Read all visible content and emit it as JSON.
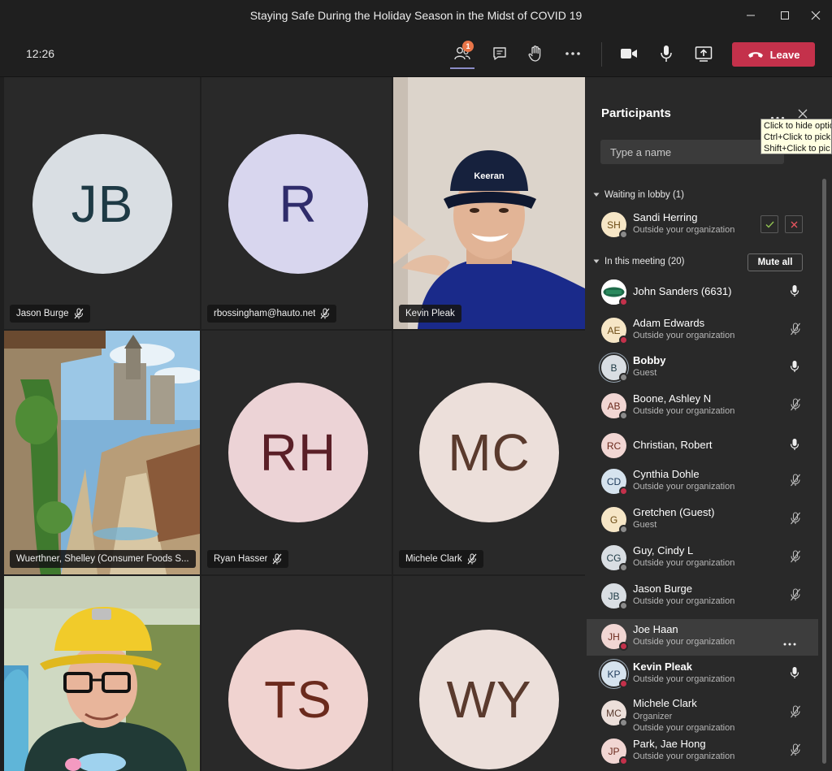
{
  "window": {
    "title": "Staying Safe During the Holiday Season in the Midst of COVID 19"
  },
  "toolbar": {
    "time": "12:26",
    "participants_badge": "1",
    "leave_label": "Leave",
    "leave_color": "#c4314b"
  },
  "tiles": [
    {
      "type": "initials",
      "initials": "JB",
      "name": "Jason Burge",
      "bg": "#d9dee3",
      "fg": "#1e3a45",
      "muted": true
    },
    {
      "type": "initials",
      "initials": "R",
      "name": "rbossingham@hauto.net",
      "bg": "#d8d6ee",
      "fg": "#2f2c6b",
      "muted": true
    },
    {
      "type": "video",
      "name": "Kevin Pleak",
      "muted": false
    },
    {
      "type": "video",
      "name": "Wuerthner, Shelley (Consumer Foods S...",
      "muted": false
    },
    {
      "type": "initials",
      "initials": "RH",
      "name": "Ryan Hasser",
      "bg": "#ecd3d6",
      "fg": "#5a1f27",
      "muted": true
    },
    {
      "type": "initials",
      "initials": "MC",
      "name": "Michele Clark",
      "bg": "#ecdfda",
      "fg": "#5a3a2d",
      "muted": true
    },
    {
      "type": "video",
      "name": "",
      "muted": false
    },
    {
      "type": "initials",
      "initials": "TS",
      "name": "",
      "bg": "#f0d3d0",
      "fg": "#6b2a1d",
      "muted": false
    },
    {
      "type": "initials",
      "initials": "WY",
      "name": "",
      "bg": "#ecdfda",
      "fg": "#5a3a2d",
      "muted": false
    }
  ],
  "panel": {
    "title": "Participants",
    "search_placeholder": "Type a name",
    "tooltip_lines": [
      "Click to hide optio",
      "Ctrl+Click to pick",
      "Shift+Click to pic"
    ],
    "lobby_label": "Waiting in lobby (1)",
    "meeting_label": "In this meeting (20)",
    "mute_all_label": "Mute all",
    "lobby": [
      {
        "initials": "SH",
        "name": "Sandi Herring",
        "sub": "Outside your organization",
        "bg": "#f6e6c6",
        "fg": "#6b4a13"
      }
    ],
    "participants": [
      {
        "initials": "",
        "name": "John Sanders (6631)",
        "sub": "",
        "logo": true,
        "mic": "on",
        "status": "#c4314b",
        "bold": false
      },
      {
        "initials": "AE",
        "name": "Adam Edwards",
        "sub": "Outside your organization",
        "bg": "#f6e6c6",
        "fg": "#6b4a13",
        "mic": "off",
        "status": "#c4314b",
        "bold": false
      },
      {
        "initials": "B",
        "name": "Bobby",
        "sub": "Guest",
        "bg": "#d9dee3",
        "fg": "#1e3a45",
        "mic": "on",
        "status": "#8a8a8a",
        "bold": true,
        "ring": true
      },
      {
        "initials": "AB",
        "name": "Boone, Ashley N",
        "sub": "Outside your organization",
        "bg": "#f1d6d3",
        "fg": "#6b2a1d",
        "mic": "off",
        "status": "#8a8a8a",
        "bold": false
      },
      {
        "initials": "RC",
        "name": "Christian, Robert",
        "sub": "",
        "bg": "#f1d6d3",
        "fg": "#6b2a1d",
        "mic": "on",
        "status": "",
        "bold": false
      },
      {
        "initials": "CD",
        "name": "Cynthia Dohle",
        "sub": "Outside your organization",
        "bg": "#d6e3ee",
        "fg": "#1e3a5a",
        "mic": "off",
        "status": "#c4314b",
        "bold": false
      },
      {
        "initials": "G",
        "name": "Gretchen (Guest)",
        "sub": "Guest",
        "bg": "#f6e6c6",
        "fg": "#6b4a13",
        "mic": "off",
        "status": "#8a8a8a",
        "bold": false
      },
      {
        "initials": "CG",
        "name": "Guy, Cindy L",
        "sub": "Outside your organization",
        "bg": "#d9dee3",
        "fg": "#1e3a45",
        "mic": "off",
        "status": "#8a8a8a",
        "bold": false
      },
      {
        "initials": "JB",
        "name": "Jason Burge",
        "sub": "Outside your organization",
        "bg": "#d9dee3",
        "fg": "#1e3a45",
        "mic": "off",
        "status": "#8a8a8a",
        "bold": false
      },
      {
        "initials": "JH",
        "name": "Joe Haan",
        "sub": "Outside your organization",
        "bg": "#f1d6d3",
        "fg": "#6b2a1d",
        "mic": "more",
        "status": "#c4314b",
        "bold": false,
        "hover": true
      },
      {
        "initials": "KP",
        "name": "Kevin Pleak",
        "sub": "Outside your organization",
        "bg": "#d6e3ee",
        "fg": "#1e3a5a",
        "mic": "on",
        "status": "#c4314b",
        "bold": true,
        "ring": true
      },
      {
        "initials": "MC",
        "name": "Michele Clark",
        "sub": "Organizer",
        "sub2": "Outside your organization",
        "bg": "#ecdfda",
        "fg": "#5a3a2d",
        "mic": "off",
        "status": "#8a8a8a",
        "bold": false
      },
      {
        "initials": "JP",
        "name": "Park, Jae Hong",
        "sub": "Outside your organization",
        "bg": "#f1d6d3",
        "fg": "#6b2a1d",
        "mic": "off",
        "status": "#c4314b",
        "bold": false
      }
    ]
  }
}
